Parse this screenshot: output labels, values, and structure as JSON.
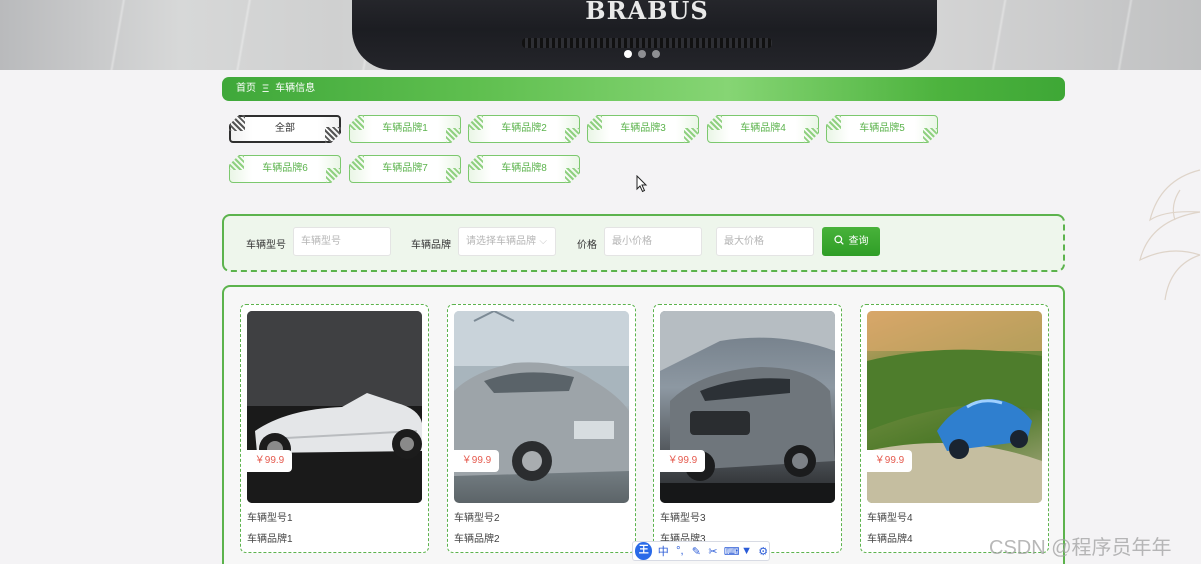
{
  "banner": {
    "plate_text": "BRABUS",
    "carousel_dots": 3,
    "active_dot": 0
  },
  "breadcrumb": {
    "home": "首页",
    "separator": "Ξ",
    "current": "车辆信息"
  },
  "categories": [
    {
      "label": "全部",
      "active": true
    },
    {
      "label": "车辆品牌1",
      "active": false
    },
    {
      "label": "车辆品牌2",
      "active": false
    },
    {
      "label": "车辆品牌3",
      "active": false
    },
    {
      "label": "车辆品牌4",
      "active": false
    },
    {
      "label": "车辆品牌5",
      "active": false
    },
    {
      "label": "车辆品牌6",
      "active": false
    },
    {
      "label": "车辆品牌7",
      "active": false
    },
    {
      "label": "车辆品牌8",
      "active": false
    }
  ],
  "search": {
    "model_label": "车辆型号",
    "model_placeholder": "车辆型号",
    "brand_label": "车辆品牌",
    "brand_placeholder": "请选择车辆品牌",
    "price_label": "价格",
    "min_price_placeholder": "最小价格",
    "max_price_placeholder": "最大价格",
    "query_button": "查询"
  },
  "products": [
    {
      "price": "￥99.9",
      "model": "车辆型号1",
      "brand": "车辆品牌1"
    },
    {
      "price": "￥99.9",
      "model": "车辆型号2",
      "brand": "车辆品牌2"
    },
    {
      "price": "￥99.9",
      "model": "车辆型号3",
      "brand": "车辆品牌3"
    },
    {
      "price": "￥99.9",
      "model": "车辆型号4",
      "brand": "车辆品牌4"
    }
  ],
  "ime_toolbar": {
    "logo": "王",
    "mode": "中"
  },
  "watermark": "CSDN @程序员年年",
  "colors": {
    "accent_green": "#5cb34d",
    "price_red": "#e55a4e",
    "breadcrumb_green": "#3fa83a"
  }
}
